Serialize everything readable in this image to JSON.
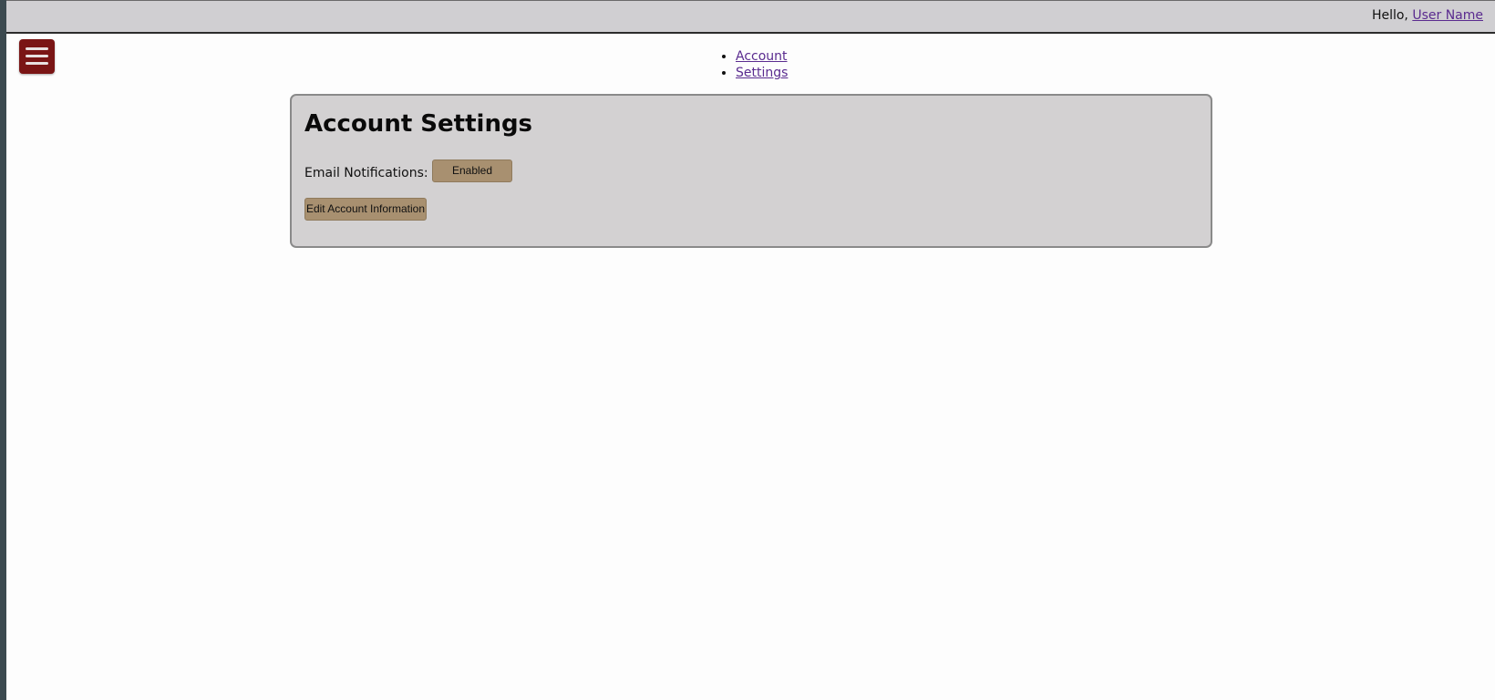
{
  "header": {
    "greeting": "Hello,",
    "user_name": "User Name"
  },
  "menu": {
    "icon": "hamburger-menu-icon",
    "color": "#7a1515"
  },
  "nav": {
    "items": [
      {
        "label": "Account"
      },
      {
        "label": "Settings"
      }
    ]
  },
  "panel": {
    "title": "Account Settings",
    "email_notifications_label": "Email Notifications:",
    "email_notifications_value": "Enabled",
    "edit_button_label": "Edit Account Information"
  },
  "colors": {
    "topbar": "#d0cfd2",
    "panel": "#d3d1d2",
    "button": "#a89070",
    "link": "#5a2b8f"
  }
}
